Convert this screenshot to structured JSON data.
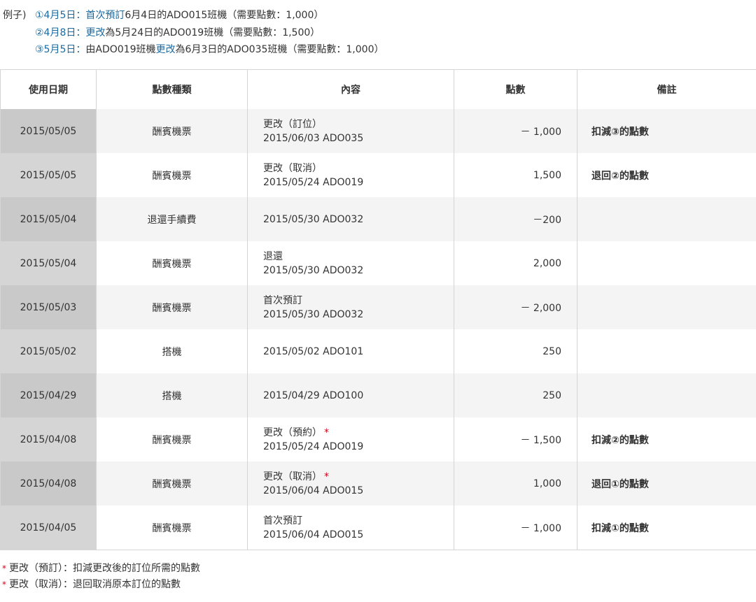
{
  "examples": {
    "prefix": "例子)",
    "lines": [
      {
        "marker": "①4月5日：首次預訂",
        "rest": "6月4日的ADO015班機（需要點數：1,000）"
      },
      {
        "marker": "②4月8日：更改",
        "rest": "為5月24日的ADO019班機（需要點數：1,500）"
      },
      {
        "marker": "③5月5日：",
        "lead": "由ADO019班機",
        "accent": "更改",
        "rest": "為6月3日的ADO035班機（需要點數：1,000）"
      }
    ]
  },
  "table": {
    "headers": [
      "使用日期",
      "點數種類",
      "內容",
      "點數",
      "備註"
    ],
    "rows": [
      {
        "date": "2015/05/05",
        "type": "酬賓機票",
        "line1": "更改（訂位）",
        "star": "",
        "line2": "2015/06/03 ADO035",
        "points": "－ 1,000",
        "note": "扣減③的點數"
      },
      {
        "date": "2015/05/05",
        "type": "酬賓機票",
        "line1": "更改（取消）",
        "star": "",
        "line2": "2015/05/24 ADO019",
        "points": "1,500",
        "note": "退回②的點數"
      },
      {
        "date": "2015/05/04",
        "type": "退還手續費",
        "line1": "2015/05/30 ADO032",
        "star": "",
        "line2": "",
        "points": "－200",
        "note": ""
      },
      {
        "date": "2015/05/04",
        "type": "酬賓機票",
        "line1": "退還",
        "star": "",
        "line2": "2015/05/30 ADO032",
        "points": "2,000",
        "note": ""
      },
      {
        "date": "2015/05/03",
        "type": "酬賓機票",
        "line1": "首次預訂",
        "star": "",
        "line2": "2015/05/30 ADO032",
        "points": "－ 2,000",
        "note": ""
      },
      {
        "date": "2015/05/02",
        "type": "搭機",
        "line1": "2015/05/02 ADO101",
        "star": "",
        "line2": "",
        "points": "250",
        "note": ""
      },
      {
        "date": "2015/04/29",
        "type": "搭機",
        "line1": "2015/04/29 ADO100",
        "star": "",
        "line2": "",
        "points": "250",
        "note": ""
      },
      {
        "date": "2015/04/08",
        "type": "酬賓機票",
        "line1": "更改（預約）",
        "star": "*",
        "line2": "2015/05/24 ADO019",
        "points": "－ 1,500",
        "note": "扣減②的點數"
      },
      {
        "date": "2015/04/08",
        "type": "酬賓機票",
        "line1": "更改（取消）",
        "star": "*",
        "line2": "2015/06/04 ADO015",
        "points": "1,000",
        "note": "退回①的點數"
      },
      {
        "date": "2015/04/05",
        "type": "酬賓機票",
        "line1": "首次預訂",
        "star": "",
        "line2": "2015/06/04 ADO015",
        "points": "－ 1,000",
        "note": "扣減①的點數"
      }
    ]
  },
  "footnotes": [
    {
      "star": "*",
      "text": "更改（預訂）：扣減更改後的訂位所需的點數"
    },
    {
      "star": "*",
      "text": "更改（取消）：退回取消原本訂位的點數"
    }
  ],
  "colors": {
    "accent": "#1a6aa0",
    "star": "#d0021b",
    "date_cell": "#d5d5d5",
    "border": "#d5d5d5"
  }
}
